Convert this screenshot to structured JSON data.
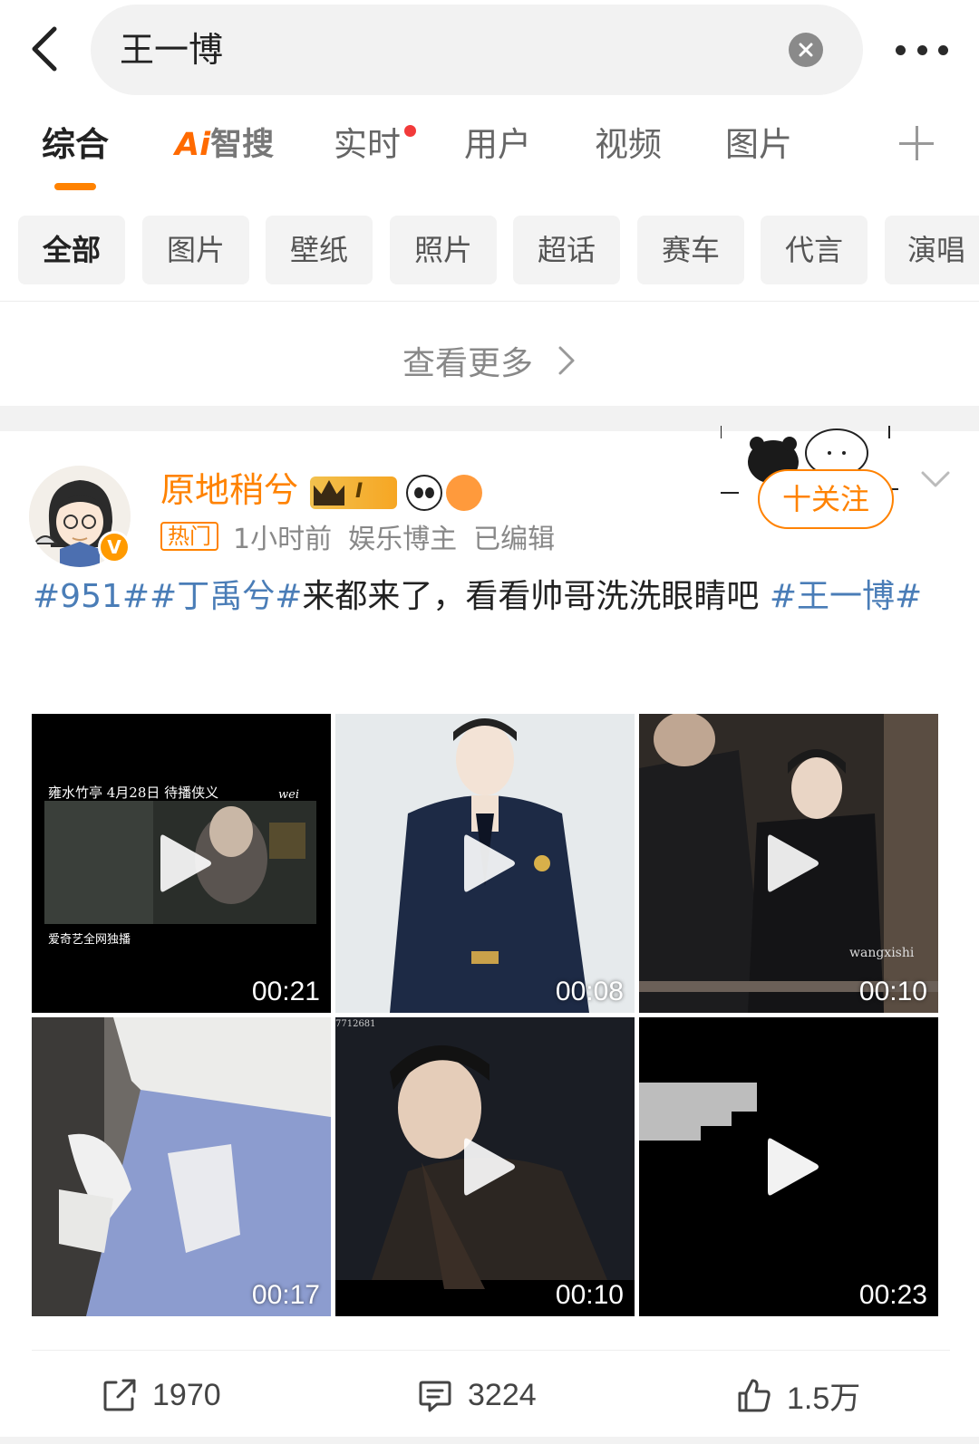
{
  "search": {
    "query": "王一博"
  },
  "tabs": [
    {
      "label": "综合",
      "active": true
    },
    {
      "label_ai": "Ai",
      "label": "智搜"
    },
    {
      "label": "实时",
      "has_dot": true
    },
    {
      "label": "用户"
    },
    {
      "label": "视频"
    },
    {
      "label": "图片"
    }
  ],
  "chips": [
    "全部",
    "图片",
    "壁纸",
    "照片",
    "超话",
    "赛车",
    "代言",
    "演唱"
  ],
  "see_more": {
    "label": "查看更多"
  },
  "post": {
    "username": "原地稍兮",
    "level_badge": "I",
    "verified_mark": "V",
    "hot_tag": "热门",
    "time": "1小时前",
    "role": "娱乐博主",
    "edited": "已编辑",
    "follow_label": "十关注",
    "text_parts": [
      {
        "text": "#951##丁禹兮#",
        "hashtag": true
      },
      {
        "text": "来都来了，看看帅哥洗洗眼睛吧 ",
        "hashtag": false
      },
      {
        "text": "#王一博#",
        "hashtag": true
      }
    ],
    "videos": [
      {
        "duration": "00:21",
        "caption_top": "雍水竹亭 4月28日 待播侠义",
        "caption_bottom": "爱奇艺全网独播",
        "watermark": "wei"
      },
      {
        "duration": "00:08"
      },
      {
        "duration": "00:10",
        "watermark": "wangxishi"
      },
      {
        "duration": "00:17"
      },
      {
        "duration": "00:10",
        "watermark": "7712681"
      },
      {
        "duration": "00:23"
      }
    ],
    "reposts": "1970",
    "comments": "3224",
    "likes": "1.5万"
  },
  "colors": {
    "accent": "#ff8200",
    "hashtag": "#4a7db7",
    "dot": "#f23a3a"
  }
}
